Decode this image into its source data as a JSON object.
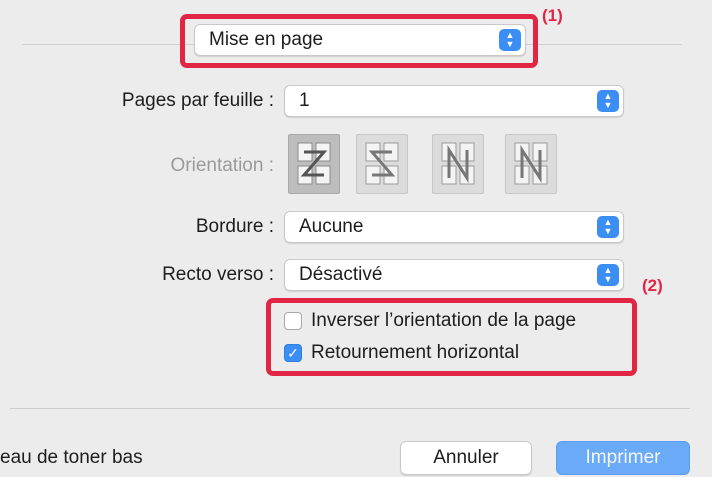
{
  "panel_menu": {
    "value": "Mise en page"
  },
  "callouts": {
    "one": "(1)",
    "two": "(2)"
  },
  "pages_per_sheet": {
    "label": "Pages par feuille :",
    "value": "1"
  },
  "orientation": {
    "label": "Orientation :",
    "options": [
      {
        "name": "Z",
        "selected": true
      },
      {
        "name": "S reversed",
        "selected": false
      },
      {
        "name": "N reversed",
        "selected": false
      },
      {
        "name": "N",
        "selected": false
      }
    ]
  },
  "border": {
    "label": "Bordure :",
    "value": "Aucune"
  },
  "duplex": {
    "label": "Recto verso :",
    "value": "Désactivé"
  },
  "checkboxes": {
    "reverse_orientation": {
      "label": "Inverser l’orientation de la page",
      "checked": false
    },
    "horizontal_flip": {
      "label": "Retournement horizontal",
      "checked": true
    }
  },
  "footer": {
    "status": "eau de toner bas",
    "cancel": "Annuler",
    "print": "Imprimer"
  },
  "colors": {
    "accent": "#3b8ef3",
    "highlight": "#e12545"
  }
}
